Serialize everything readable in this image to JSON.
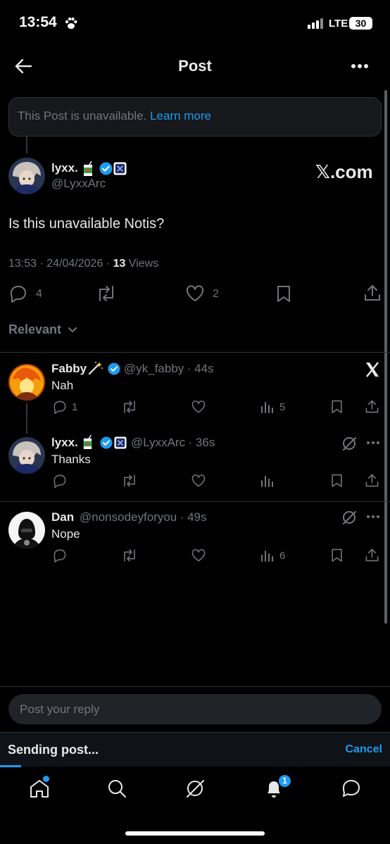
{
  "status_bar": {
    "time": "13:54",
    "network": "LTE",
    "battery": "30"
  },
  "header": {
    "title": "Post"
  },
  "unavailable": {
    "text": "This Post is unavailable.",
    "link": "Learn more"
  },
  "main_post": {
    "name": "lyxx.",
    "handle": "@LyxxArc",
    "watermark": "𝕏.com",
    "text": "Is this unavailable Notis?",
    "timestamp": "13:53 · 24/04/2026 · ",
    "views_count": "13",
    "views_label": " Views",
    "replies": "4",
    "likes": "2"
  },
  "sort": {
    "label": "Relevant"
  },
  "replies": [
    {
      "name": "Fabby",
      "handle": "@yk_fabby",
      "time": "· 44s",
      "text": "Nah",
      "replies": "1",
      "views": "5"
    },
    {
      "name": "lyxx.",
      "handle": "@LyxxArc",
      "time": "· 36s",
      "text": "Thanks",
      "replies": "",
      "views": ""
    },
    {
      "name": "Dan",
      "handle": "@nonsodeyforyou",
      "time": "· 49s",
      "text": "Nope",
      "replies": "",
      "views": "6"
    }
  ],
  "compose": {
    "placeholder": "Post your reply"
  },
  "sending": {
    "label": "Sending post...",
    "cancel": "Cancel"
  },
  "nav": {
    "notifications_badge": "1"
  },
  "colors": {
    "accent": "#1d9bf0",
    "background": "#000000",
    "text": "#e7e9ea",
    "muted": "#71767b"
  }
}
